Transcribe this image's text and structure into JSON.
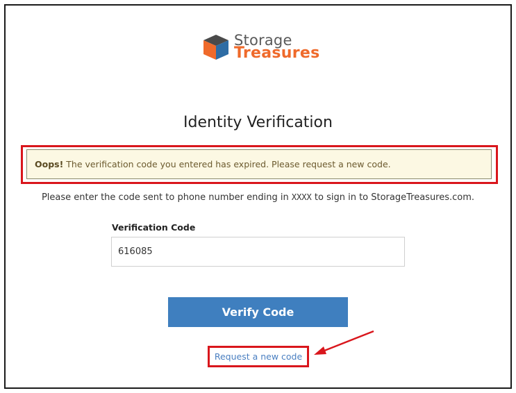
{
  "logo": {
    "word1": "Storage",
    "word2": "Treasures"
  },
  "title": "Identity Verification",
  "alert": {
    "strong": "Oops!",
    "message": " The verification code you entered has expired. Please request a new code."
  },
  "instructions": {
    "before": "Please enter the code sent to phone number ending in ",
    "masked": "XXXX",
    "after": " to sign in to StorageTreasures.com."
  },
  "form": {
    "label": "Verification Code",
    "value": "616085"
  },
  "verify_button": "Verify Code",
  "request_link": "Request a new code",
  "colors": {
    "brand_orange": "#ef6a2b",
    "button_blue": "#3f7fbf",
    "highlight_red": "#d9161c",
    "alert_bg": "#fcf8e3"
  },
  "icons": [
    "box-logo-icon",
    "annotation-arrow-icon"
  ]
}
